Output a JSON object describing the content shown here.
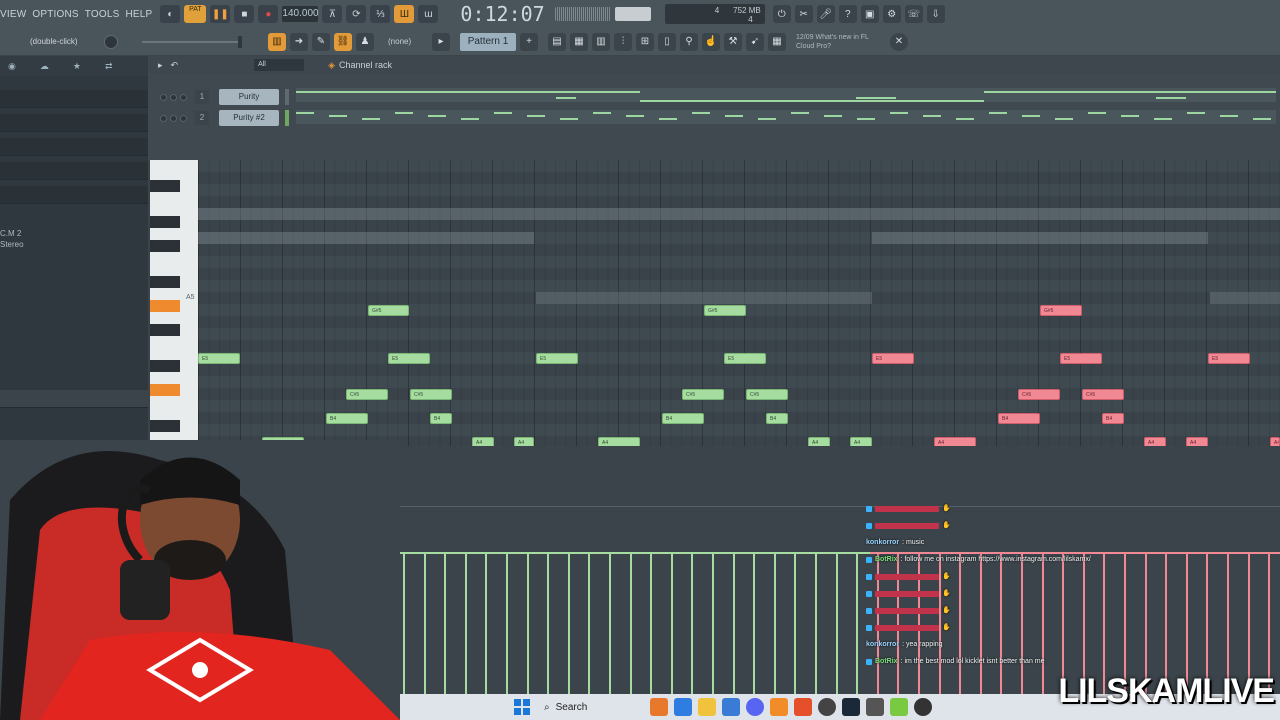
{
  "menu": [
    "VIEW",
    "OPTIONS",
    "TOOLS",
    "HELP"
  ],
  "transport": {
    "mode": "PAT",
    "tempo": "140.000",
    "time": "0:12:07",
    "time_sub": "M:S:CS"
  },
  "cpu": {
    "voices": "4",
    "memory": "752 MB",
    "load": "4"
  },
  "toolbar2": {
    "hint": "(double-click)",
    "snap": "(none)",
    "pattern": "Pattern 1"
  },
  "news": {
    "date": "12/09",
    "line1": "What's new in FL",
    "line2": "Cloud Pro?"
  },
  "channel_rack": {
    "filter": "All",
    "title": "Channel rack",
    "channels": [
      {
        "num": "1",
        "name": "Purity"
      },
      {
        "num": "2",
        "name": "Purity #2"
      }
    ],
    "add": "+"
  },
  "browser": {
    "label1": "C.M 2",
    "label2": "Stereo"
  },
  "piano": {
    "key_label": "A5"
  },
  "notes": {
    "green": [
      {
        "label": "G#5"
      },
      {
        "label": "E5"
      },
      {
        "label": "C#5"
      },
      {
        "label": "B4"
      },
      {
        "label": "A4"
      },
      {
        "label": "G#4"
      }
    ]
  },
  "chat": [
    {
      "user": "",
      "text": "",
      "kind": "red"
    },
    {
      "user": "",
      "text": "",
      "kind": "red"
    },
    {
      "user": "konkorror",
      "text": "music",
      "kind": "plain"
    },
    {
      "user": "BotRix",
      "text": "follow me on instagram https://www.instagram.com/lilskamx/",
      "kind": "bot"
    },
    {
      "user": "",
      "text": "",
      "kind": "red"
    },
    {
      "user": "",
      "text": "",
      "kind": "red"
    },
    {
      "user": "",
      "text": "",
      "kind": "red"
    },
    {
      "user": "",
      "text": "",
      "kind": "red"
    },
    {
      "user": "konkorror",
      "text": "yea rapping",
      "kind": "plain"
    },
    {
      "user": "BotRix",
      "text": "im the best mod lol kicklet isnt better than me",
      "kind": "bot"
    }
  ],
  "taskbar": {
    "search": "Search"
  },
  "watermark": "LILSKAMLIVE",
  "colors": {
    "accent": "#e39a38",
    "note_green": "#a6dca0",
    "note_red": "#f08994",
    "bg": "#3a444b"
  }
}
